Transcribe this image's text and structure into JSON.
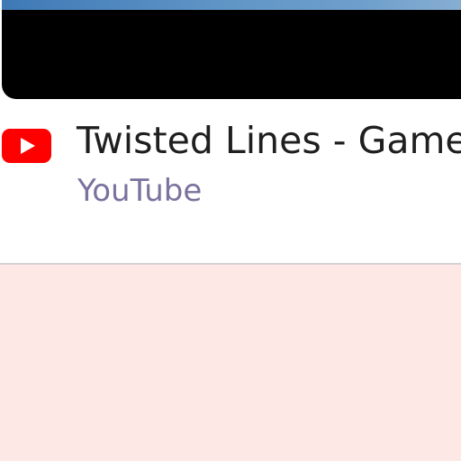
{
  "result": {
    "title": "Twisted Lines - Game",
    "source": "YouTube",
    "source_icon": "youtube-icon",
    "icon_color": "#ff0000"
  }
}
